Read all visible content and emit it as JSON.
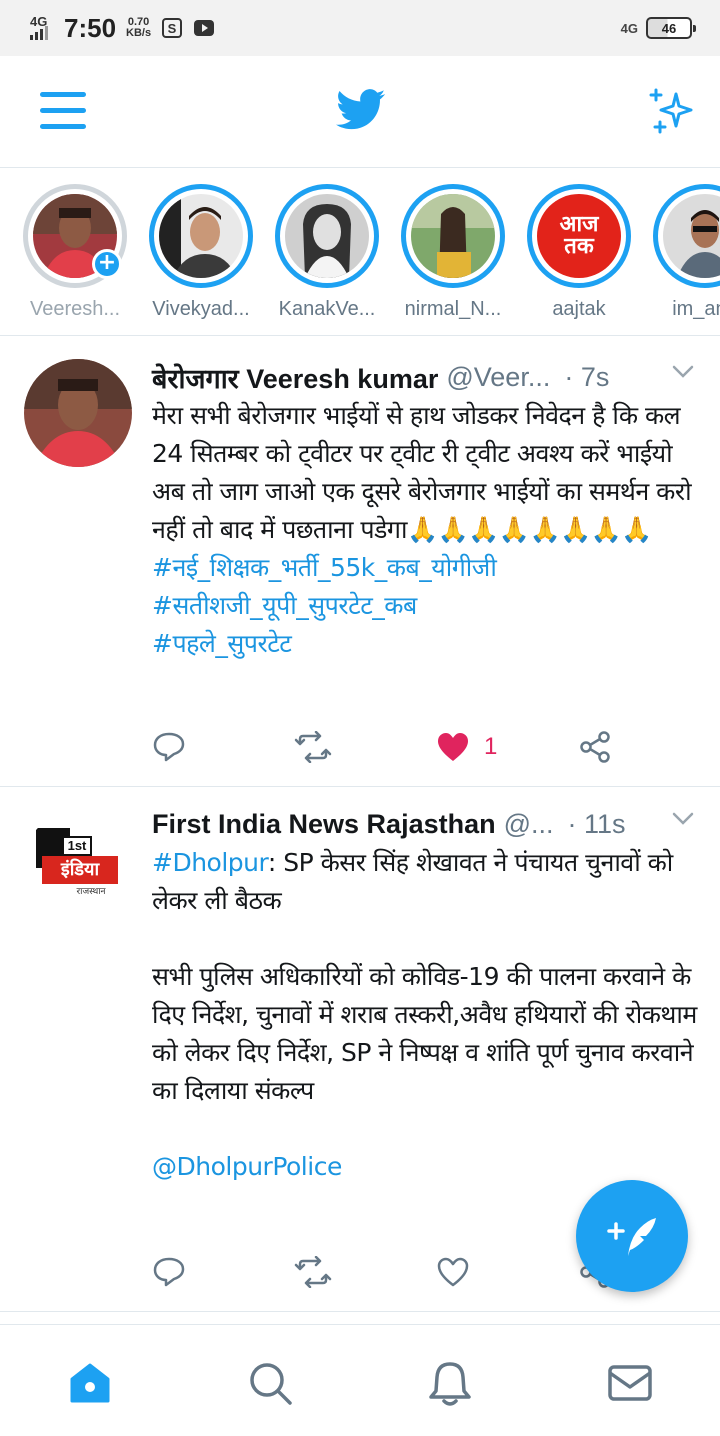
{
  "status_bar": {
    "network_left": "4G",
    "time": "7:50",
    "speed_value": "0.70",
    "speed_unit": "KB/s",
    "network_right": "4G",
    "battery": "46"
  },
  "top_bar": {
    "menu_icon": "hamburger-menu-icon",
    "logo_icon": "twitter-bird-icon",
    "sparkle_icon": "sparkle-icon"
  },
  "fleets": [
    {
      "name": "Veeresh...",
      "seen": true,
      "own": true
    },
    {
      "name": "Vivekyad...",
      "seen": false
    },
    {
      "name": "KanakVe...",
      "seen": false
    },
    {
      "name": "nirmal_N...",
      "seen": false
    },
    {
      "name": "aajtak",
      "seen": false,
      "logo_top": "आज",
      "logo_bottom": "तक"
    },
    {
      "name": "im_anu",
      "seen": false
    }
  ],
  "tweets": [
    {
      "name": "बेरोजगार Veeresh kumar",
      "handle": "@Veer...",
      "time": "· 7s",
      "body": "मेरा सभी बेरोजगार भाईयों से हाथ जोडकर निवेदन है कि कल 24 सितम्बर को ट्वीटर पर ट्वीट री ट्वीट अवश्य करें भाईयो अब तो जाग जाओ एक दूसरे बेरोजगार भाईयों का समर्थन करो नहीं तो बाद में पछताना पडेगा🙏🙏🙏🙏🙏🙏🙏🙏",
      "hashtags": [
        "#नई_शिक्षक_भर्ती_55k_कब_योगीजी",
        "#सतीशजी_यूपी_सुपरटेट_कब",
        "#पहले_सुपरटेट"
      ],
      "like_count": "1",
      "liked": true
    },
    {
      "name": "First India News Rajasthan",
      "handle": "@...",
      "time": "· 11s",
      "hashtag_inline": "#Dholpur",
      "body_line1": ": SP केसर सिंह शेखावत ने पंचायत चुनावों को लेकर ली बैठक",
      "body_para2": "सभी पुलिस अधिकारियों को कोविड-19 की पालना करवाने के दिए निर्देश, चुनावों में शराब तस्करी,अवैध हथियारों की रोकथाम को लेकर दिए निर्देश, SP ने निष्पक्ष व शांति पूर्ण चुनाव करवाने का दिलाया संकल्प",
      "mention": "@DholpurPolice",
      "logo_top": "1st",
      "logo_main": "इंडिया",
      "logo_sub": "राजस्थान",
      "liked": false
    }
  ],
  "colors": {
    "accent": "#1da1f2",
    "like": "#e0245e",
    "text": "#14171a",
    "muted": "#657786"
  },
  "fab_icon": "compose-tweet-icon",
  "bottom_nav": [
    "home-icon",
    "search-icon",
    "notifications-icon",
    "messages-icon"
  ]
}
